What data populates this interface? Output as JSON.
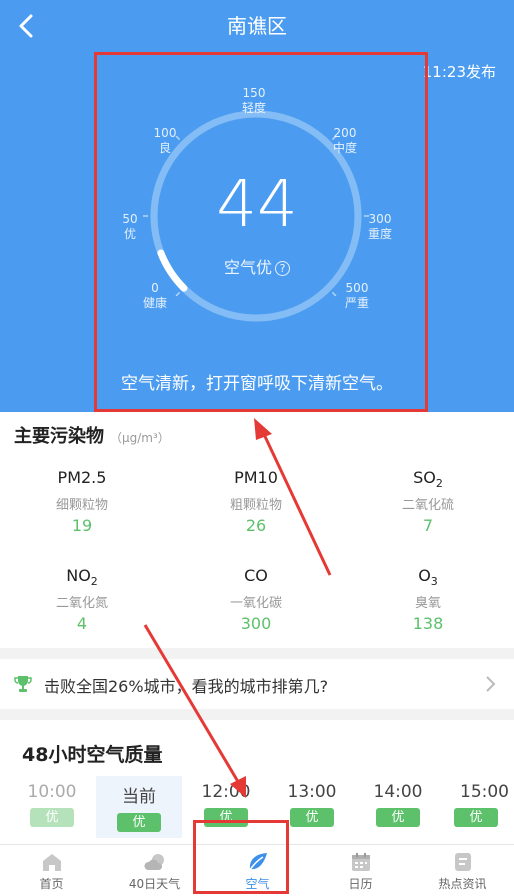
{
  "header": {
    "title": "南谯区",
    "publish_time": "11:23发布"
  },
  "aqi": {
    "value": "44",
    "level": "空气优",
    "help": "?",
    "advice": "空气清新，打开窗呼吸下清新空气。",
    "progress_fraction": 0.088,
    "scale": [
      {
        "value": "0",
        "label": "健康"
      },
      {
        "value": "50",
        "label": "优"
      },
      {
        "value": "100",
        "label": "良"
      },
      {
        "value": "150",
        "label": "轻度"
      },
      {
        "value": "200",
        "label": "中度"
      },
      {
        "value": "300",
        "label": "重度"
      },
      {
        "value": "500",
        "label": "严重"
      }
    ]
  },
  "pollutants": {
    "title": "主要污染物",
    "unit": "（μg/m³）",
    "items": [
      {
        "name": "PM2.5",
        "sub": "",
        "cn": "细颗粒物",
        "value": "19"
      },
      {
        "name": "PM10",
        "sub": "",
        "cn": "粗颗粒物",
        "value": "26"
      },
      {
        "name": "SO",
        "sub": "2",
        "cn": "二氧化硫",
        "value": "7"
      },
      {
        "name": "NO",
        "sub": "2",
        "cn": "二氧化氮",
        "value": "4"
      },
      {
        "name": "CO",
        "sub": "",
        "cn": "一氧化碳",
        "value": "300"
      },
      {
        "name": "O",
        "sub": "3",
        "cn": "臭氧",
        "value": "138"
      }
    ]
  },
  "rank": {
    "text": "击败全国26%城市，看我的城市排第几?"
  },
  "hourly": {
    "title": "48小时空气质量",
    "items": [
      {
        "time": "10:00",
        "level": "优",
        "past": true
      },
      {
        "time": "当前",
        "level": "优",
        "now": true
      },
      {
        "time": "12:00",
        "level": "优"
      },
      {
        "time": "13:00",
        "level": "优"
      },
      {
        "time": "14:00",
        "level": "优"
      },
      {
        "time": "15:00",
        "level": "优"
      }
    ]
  },
  "tabs": [
    {
      "label": "首页",
      "icon": "home-icon"
    },
    {
      "label": "40日天气",
      "icon": "cloud-icon"
    },
    {
      "label": "空气",
      "icon": "leaf-icon",
      "active": true
    },
    {
      "label": "日历",
      "icon": "calendar-icon"
    },
    {
      "label": "热点资讯",
      "icon": "news-icon"
    }
  ],
  "colors": {
    "hero": "#4b9cf0",
    "good": "#5cc16a",
    "annotation": "#e53935",
    "active_tab": "#3d8fe8"
  }
}
